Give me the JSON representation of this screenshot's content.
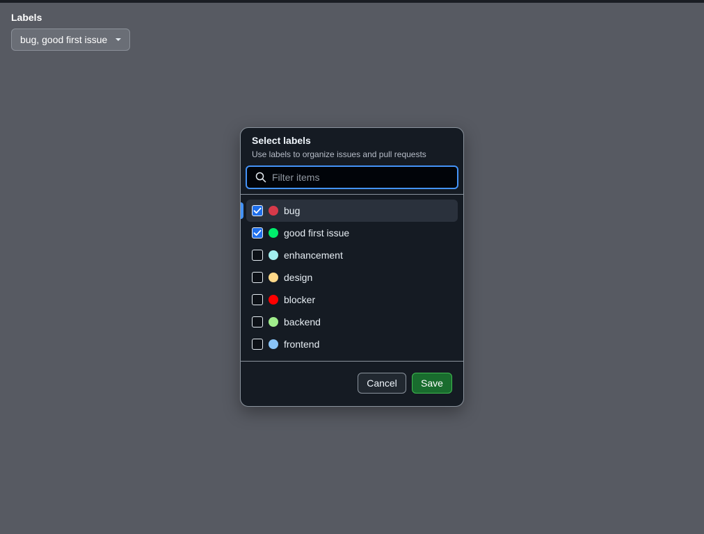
{
  "field": {
    "label": "Labels",
    "value": "bug, good first issue"
  },
  "dialog": {
    "title": "Select labels",
    "subtitle": "Use labels to organize issues and pull requests",
    "filter_placeholder": "Filter items",
    "filter_value": "",
    "items": [
      {
        "label": "bug",
        "color": "#d73a4a",
        "checked": true,
        "active": true
      },
      {
        "label": "good first issue",
        "color": "#00ee6c",
        "checked": true,
        "active": false
      },
      {
        "label": "enhancement",
        "color": "#a2eeef",
        "checked": false,
        "active": false
      },
      {
        "label": "design",
        "color": "#ffd989",
        "checked": false,
        "active": false
      },
      {
        "label": "blocker",
        "color": "#ff0000",
        "checked": false,
        "active": false
      },
      {
        "label": "backend",
        "color": "#a0ed8c",
        "checked": false,
        "active": false
      },
      {
        "label": "frontend",
        "color": "#89c4f8",
        "checked": false,
        "active": false
      }
    ],
    "cancel_label": "Cancel",
    "save_label": "Save"
  }
}
